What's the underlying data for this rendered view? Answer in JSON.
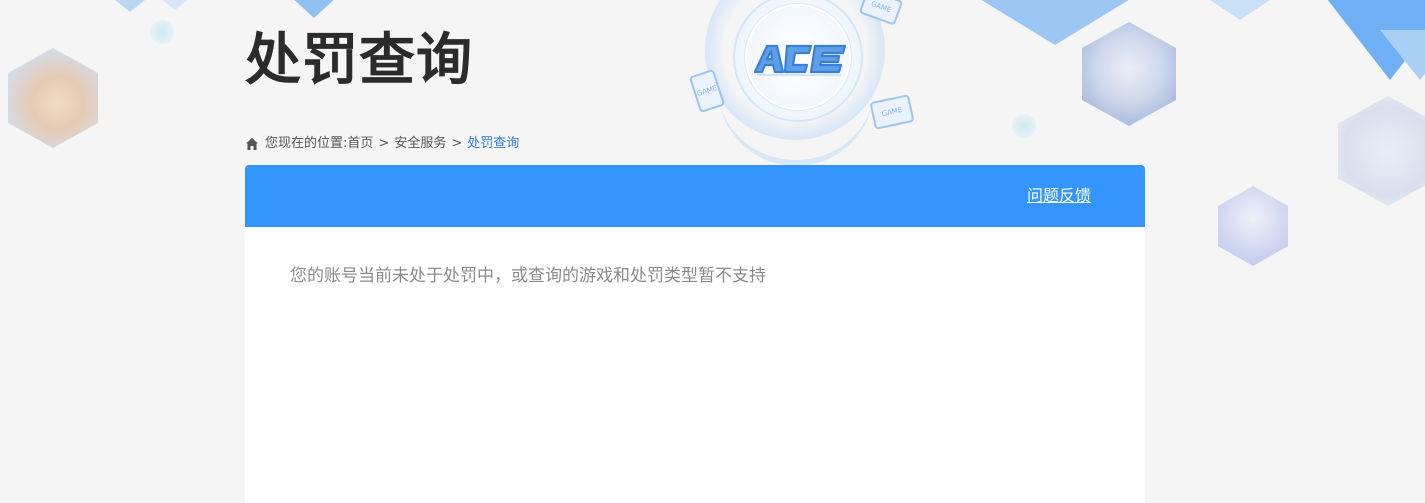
{
  "page": {
    "title": "处罚查询"
  },
  "breadcrumb": {
    "prefix": "您现在的位置:",
    "items": [
      {
        "label": "首页"
      },
      {
        "label": "安全服务"
      },
      {
        "label": "处罚查询"
      }
    ],
    "separator": ">"
  },
  "panel": {
    "header_color": "#3595fe",
    "feedback_label": "问题反馈",
    "message": "您的账号当前未处于处罚中，或查询的游戏和处罚类型暂不支持"
  },
  "decor": {
    "emblem_text": "ACE",
    "game_label": "GAME"
  },
  "colors": {
    "accent": "#3595fe",
    "link_active": "#2b7fd1",
    "title": "#2b2b2b"
  }
}
